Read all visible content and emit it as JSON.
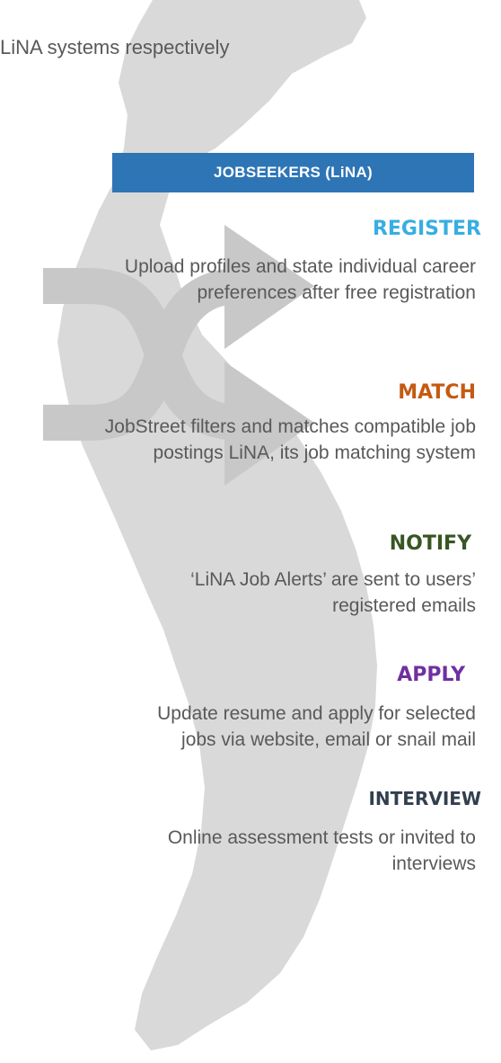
{
  "top_caption": "LiNA systems respectively",
  "header": {
    "label": "JOBSEEKERS (LiNA)",
    "color": "#2e75b6"
  },
  "steps": [
    {
      "title": "REGISTER",
      "description": "Upload profiles and state individual career preferences after free registration",
      "color": "#37aee2"
    },
    {
      "title": "MATCH",
      "description": "JobStreet filters and matches compatible job postings LiNA, its job matching system",
      "color": "#c55a11"
    },
    {
      "title": "NOTIFY",
      "description": "‘LiNA Job Alerts’ are sent to users’ registered emails",
      "color": "#375623"
    },
    {
      "title": "APPLY",
      "description": "Update resume and apply for selected jobs via website, email or snail mail",
      "color": "#7030a0"
    },
    {
      "title": "INTERVIEW",
      "description": "Online assessment tests or invited to interviews",
      "color": "#323f4f"
    }
  ],
  "icons": {
    "background": "vietnam-map-silhouette",
    "overlay": "shuffle-icon"
  }
}
